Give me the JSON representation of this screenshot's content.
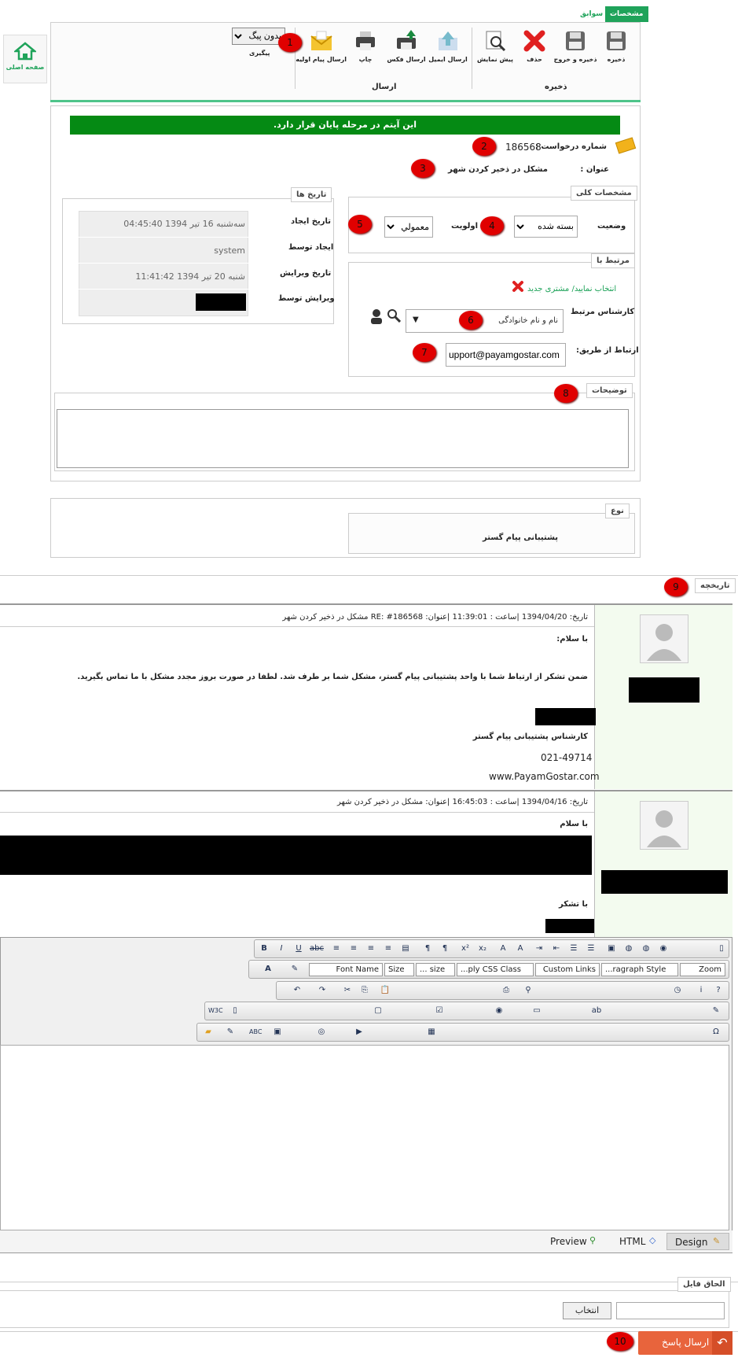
{
  "tabs": {
    "active": "مشخصات",
    "other": "سوابق"
  },
  "home": {
    "label": "صفحه اصلی"
  },
  "toolbar": {
    "save": "ذخیره",
    "save_exit": "ذخیره و خروج",
    "delete": "حذف",
    "preview": "پیش نمایش",
    "send_email": "ارسال ایمیل",
    "send_fax": "ارسال فکس",
    "print": "چاپ",
    "send_initial": "ارسال پیام اولیه",
    "group_save": "ذخیره",
    "group_send": "ارسال",
    "followup_select": "بدون پیگ",
    "followup_label": "پیگیری"
  },
  "banner": "این آیتم در مرحله پایان قرار دارد.",
  "request": {
    "number_label": "شماره درخواست :",
    "number": "186568",
    "title_label": "عنوان :",
    "title": "مشکل در ذخیر کردن شهر"
  },
  "general": {
    "legend": "مشخصات کلی",
    "status_label": "وضعیت",
    "status": "بسته شده",
    "priority_label": "اولویت",
    "priority": "معمولي"
  },
  "dates": {
    "legend": "تاریخ ها",
    "created_label": "تاریخ ایجاد",
    "created": "سه‌شنبه 16 تیر 1394 04:45:40",
    "created_by_label": "ایجاد توسط",
    "created_by": "system",
    "edited_label": "تاریخ ویرایش",
    "edited": "شنبه 20 تیر 1394 11:41:42",
    "edited_by_label": "ویرایش توسط"
  },
  "related": {
    "legend": "مرتبط با",
    "new_link": "انتخاب نمایید/ مشتری جدید",
    "expert_label": "کارشناس مرتبط",
    "expert_placeholder": "نام و نام خانوادگی",
    "via_label": "ارتباط از طریق:",
    "via": "upport@payamgostar.com"
  },
  "description": {
    "legend": "توضیحات"
  },
  "type": {
    "legend": "نوع",
    "value": "پشتیبانی پیام گستر"
  },
  "history": {
    "legend": "تاریخچه"
  },
  "messages": [
    {
      "header": "تاریخ: 1394/04/20 |ساعت : 11:39:01 |عنوان: RE: #186568 مشکل در ذخیر کردن شهر",
      "greeting": "با سلام:",
      "body": "ضمن تشکر از ارتباط شما با واحد پشتیبانی پیام گستر، مشکل شما بر طرف شد. لطفا در صورت بروز مجدد مشکل با ما تماس بگیرید.",
      "role": "کارشناس پشتیبانی پیام گستر",
      "phone": "021-49714",
      "site": "www.PayamGostar.com"
    },
    {
      "header": "تاریخ: 1394/04/16 |ساعت : 16:45:03 |عنوان: مشکل در ذخیر کردن شهر",
      "greeting": "با سلام",
      "closing": "با تشکر"
    }
  ],
  "editor": {
    "font_name": "Font Name",
    "size": "Size",
    "size2": "... size",
    "css_class": "...ply CSS Class",
    "custom_links": "Custom Links",
    "paragraph": "...ragraph Style",
    "zoom": "Zoom",
    "preview": "Preview",
    "html": "HTML",
    "design": "Design"
  },
  "attach": {
    "legend": "الحاق فایل",
    "choose": "انتخاب"
  },
  "send_reply": "ارسال پاسخ",
  "markers": [
    "1",
    "2",
    "3",
    "4",
    "5",
    "6",
    "7",
    "8",
    "9",
    "10"
  ],
  "colors": {
    "accent": "#1fa35a",
    "banner": "#058a14",
    "marker": "#e00000",
    "reply": "#e8643c"
  }
}
